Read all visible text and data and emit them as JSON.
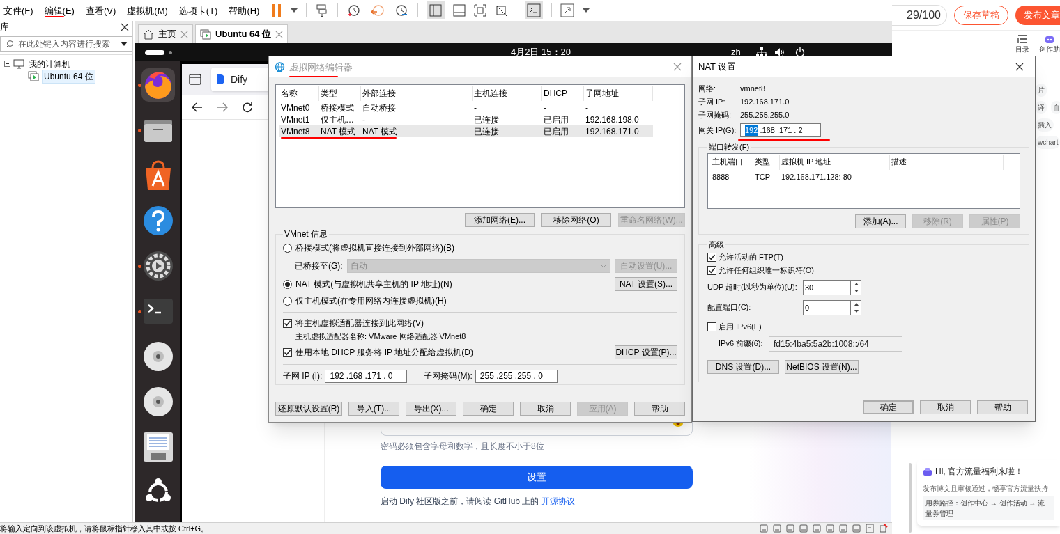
{
  "menu": [
    {
      "label": "文件(F)",
      "annotated": false
    },
    {
      "label": "编辑(E)",
      "annotated": true
    },
    {
      "label": "查看(V)",
      "annotated": false
    },
    {
      "label": "虚拟机(M)",
      "annotated": false
    },
    {
      "label": "选项卡(T)",
      "annotated": false
    },
    {
      "label": "帮助(H)",
      "annotated": false
    }
  ],
  "library": {
    "title": "库",
    "search_placeholder": "在此处键入内容进行搜索",
    "tree": [
      {
        "label": "我的计算机",
        "expanded": true,
        "selected": false,
        "children": [
          {
            "label": "Ubuntu 64 位",
            "selected": true
          }
        ]
      }
    ]
  },
  "tabs": [
    {
      "kind": "home",
      "label": "主页",
      "selected": false
    },
    {
      "kind": "vm",
      "label": "Ubuntu 64 位",
      "selected": true
    }
  ],
  "guest": {
    "clock": "4月2日 15：20",
    "input_method": "zh",
    "dock": [
      {
        "kind": "firefox",
        "running": true
      },
      {
        "kind": "files",
        "running": true
      },
      {
        "kind": "app-center",
        "running": false
      },
      {
        "kind": "help",
        "running": false
      },
      {
        "kind": "settings",
        "running": true
      },
      {
        "kind": "terminal",
        "running": true
      },
      {
        "kind": "disc",
        "running": false
      },
      {
        "kind": "disc",
        "running": false
      },
      {
        "kind": "floppy",
        "running": false
      },
      {
        "kind": "ubuntu",
        "running": false
      }
    ]
  },
  "browser": {
    "tab": "Dify",
    "page": {
      "password_hint": "密码必须包含字母和数字，且长度不小于8位",
      "submit": "设置",
      "notice": "启动 Dify 社区版之前，请阅读 GitHub 上的 ",
      "notice_link": "开源协议"
    }
  },
  "network_editor": {
    "title": "虚拟网络编辑器",
    "title_annotated": true,
    "table": {
      "columns": [
        "名称",
        "类型",
        "外部连接",
        "主机连接",
        "DHCP",
        "子网地址"
      ],
      "rows": [
        {
          "cells": [
            "VMnet0",
            "桥接模式",
            "自动桥接",
            "-",
            "-",
            "-"
          ],
          "selected": false,
          "annotated": false
        },
        {
          "cells": [
            "VMnet1",
            "仅主机…",
            "-",
            "已连接",
            "已启用",
            "192.168.198.0"
          ],
          "selected": false,
          "annotated": false
        },
        {
          "cells": [
            "VMnet8",
            "NAT 模式",
            "NAT 模式",
            "已连接",
            "已启用",
            "192.168.171.0"
          ],
          "selected": true,
          "annotated": true
        }
      ]
    },
    "list_buttons": [
      {
        "label": "添加网络(E)...",
        "disabled": false
      },
      {
        "label": "移除网络(O)",
        "disabled": false
      },
      {
        "label": "重命名网络(W)...",
        "disabled": true
      }
    ],
    "group": "VMnet 信息",
    "modes": [
      {
        "label": "桥接模式(将虚拟机直接连接到外部网络)(B)",
        "selected": false
      },
      {
        "label": "NAT 模式(与虚拟机共享主机的 IP 地址)(N)",
        "selected": true
      },
      {
        "label": "仅主机模式(在专用网络内连接虚拟机)(H)",
        "selected": false
      }
    ],
    "bridged_to": {
      "label": "已桥接至(G):",
      "value": "自动",
      "disabled": true
    },
    "auto_button": {
      "label": "自动设置(U)...",
      "disabled": true
    },
    "nat_button": {
      "label": "NAT 设置(S)...",
      "disabled": false
    },
    "options": [
      {
        "label": "将主机虚拟适配器连接到此网络(V)",
        "checked": true
      },
      {
        "label": "使用本地 DHCP 服务将 IP 地址分配给虚拟机(D)",
        "checked": true
      }
    ],
    "adapter_name": "主机虚拟适配器名称: VMware 网络适配器 VMnet8",
    "dhcp_button": {
      "label": "DHCP 设置(P)...",
      "disabled": false
    },
    "subnet_ip": {
      "label": "子网 IP (I):",
      "value": "192 .168 .171 . 0"
    },
    "subnet_mask": {
      "label": "子网掩码(M):",
      "value": "255 .255 .255 . 0"
    },
    "buttons": [
      {
        "label": "还原默认设置(R)",
        "disabled": false
      },
      {
        "label": "导入(T)...",
        "disabled": false
      },
      {
        "label": "导出(X)...",
        "disabled": false
      },
      {
        "label": "确定",
        "disabled": false
      },
      {
        "label": "取消",
        "disabled": false
      },
      {
        "label": "应用(A)",
        "disabled": true
      },
      {
        "label": "帮助",
        "disabled": false
      }
    ]
  },
  "nat_settings": {
    "title": "NAT 设置",
    "info": [
      {
        "label": "网络:",
        "value": "vmnet8"
      },
      {
        "label": "子网 IP:",
        "value": "192.168.171.0"
      },
      {
        "label": "子网掩码:",
        "value": "255.255.255.0"
      }
    ],
    "gateway": {
      "label": "网关 IP(G):",
      "annotated": true,
      "segments": [
        {
          "text": "192",
          "selected": true
        },
        {
          "text": " .168 .171 . 2",
          "selected": false
        }
      ]
    },
    "port_forwarding": {
      "title": "端口转发(F)",
      "columns": [
        "主机端口",
        "类型",
        "虚拟机 IP 地址",
        "描述"
      ],
      "rows": [
        {
          "cells": [
            "8888",
            "TCP",
            "192.168.171.128: 80"
          ]
        }
      ],
      "buttons": [
        {
          "label": "添加(A)...",
          "disabled": false
        },
        {
          "label": "移除(R)",
          "disabled": true
        },
        {
          "label": "属性(P)",
          "disabled": true
        }
      ]
    },
    "advanced": {
      "title": "高级",
      "options": [
        {
          "label": "允许活动的 FTP(T)",
          "checked": true
        },
        {
          "label": "允许任何组织唯一标识符(O)",
          "checked": true
        }
      ],
      "udp_timeout": {
        "label": "UDP 超时(以秒为单位)(U):",
        "value": "30"
      },
      "config_port": {
        "label": "配置端口(C):",
        "value": "0"
      },
      "ipv6": {
        "label": "启用 IPv6(E)",
        "checked": false
      },
      "ipv6_prefix": {
        "label": "IPv6 前缀(6):",
        "value": "fd15:4ba5:5a2b:1008::/64"
      },
      "buttons": [
        {
          "label": "DNS 设置(D)..."
        },
        {
          "label": "NetBIOS 设置(N)..."
        }
      ]
    },
    "buttons": [
      {
        "label": "确定",
        "default": true
      },
      {
        "label": "取消",
        "default": false
      },
      {
        "label": "帮助",
        "default": false
      }
    ]
  },
  "csdn": {
    "counter": "29/100",
    "save_draft": "保存草稿",
    "publish": "发布文章",
    "tools": [
      {
        "kind": "outline",
        "label": "目录"
      },
      {
        "kind": "assistant",
        "label": "创作助"
      }
    ],
    "chip_rows": [
      [
        "片"
      ],
      [
        "译",
        "自"
      ],
      [
        "插入"
      ],
      [
        "wchart"
      ]
    ],
    "promo": {
      "title": "Hi, 官方流量福利来啦！",
      "text": "发布博文且审核通过，畅享官方流量扶持",
      "path": "用券路径：创作中心 → 创作活动 → 流量券管理"
    }
  },
  "status_bar": {
    "message": "将输入定向到该虚拟机，请将鼠标指针移入其中或按 Ctrl+G。"
  }
}
